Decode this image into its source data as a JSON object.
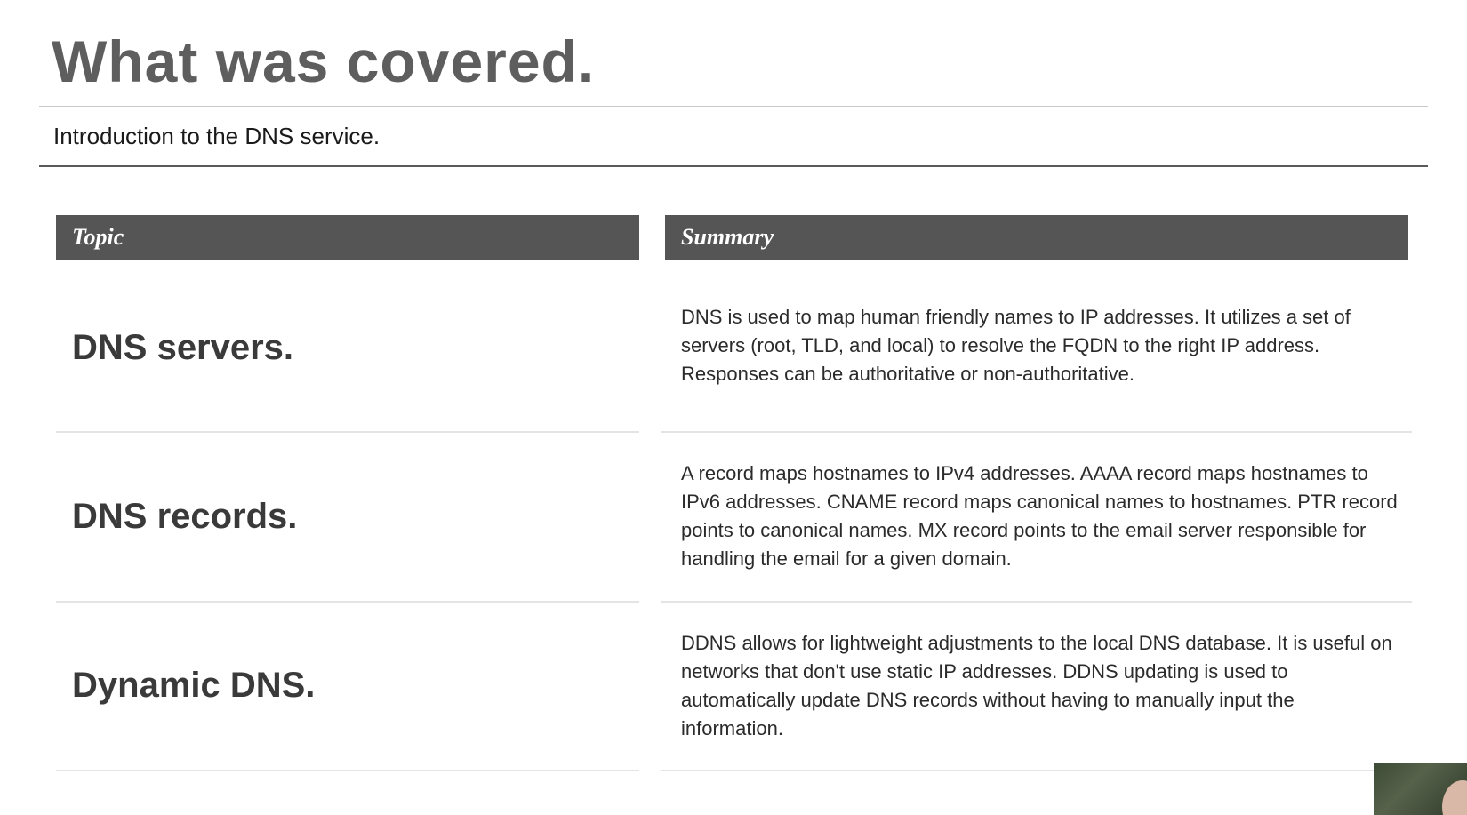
{
  "slide": {
    "title": "What was covered.",
    "subtitle": "Introduction to the DNS service."
  },
  "table": {
    "headers": {
      "topic": "Topic",
      "summary": "Summary"
    },
    "rows": [
      {
        "topic": "DNS servers.",
        "summary": "DNS is used to map human friendly names to IP addresses. It utilizes a set of servers (root, TLD, and local) to resolve the FQDN to the right IP address. Responses can be authoritative or non-authoritative."
      },
      {
        "topic": "DNS records.",
        "summary": "A record maps hostnames to IPv4 addresses. AAAA record maps hostnames to IPv6 addresses. CNAME record maps canonical names to hostnames. PTR record points to canonical names. MX record points to the email server responsible for handling the email for a given domain."
      },
      {
        "topic": "Dynamic DNS.",
        "summary": "DDNS allows for lightweight adjustments to the local DNS database. It is useful on networks that don't use static IP addresses. DDNS updating is used to automatically update DNS records without having to manually input the information."
      }
    ]
  }
}
